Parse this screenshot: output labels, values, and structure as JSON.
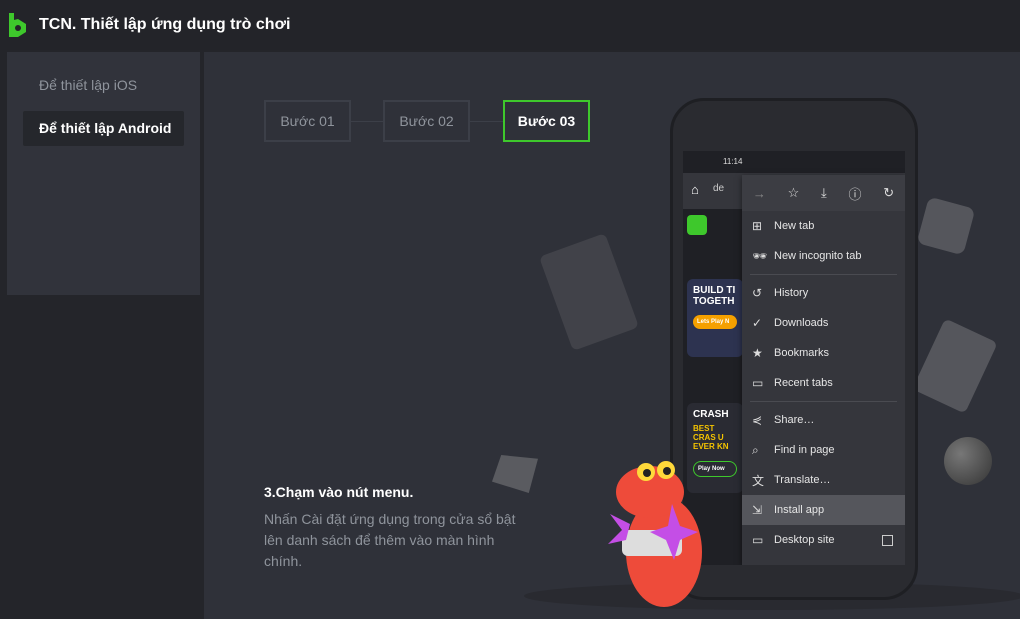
{
  "header": {
    "title": "TCN. Thiết lập ứng dụng trò chơi",
    "logo_color": "#3ec82c"
  },
  "sidebar": {
    "items": [
      {
        "label": "Để thiết lập iOS"
      },
      {
        "label": "Để thiết lập Android",
        "active": true
      }
    ]
  },
  "steps": [
    {
      "label": "Bước 01"
    },
    {
      "label": "Bước 02"
    },
    {
      "label": "Bước 03",
      "active": true
    }
  ],
  "instruction": {
    "title": "3.Chạm vào nút menu.",
    "text": "Nhấn Cài đặt ứng dụng trong cửa sổ bật lên danh sách để thêm vào màn hình chính."
  },
  "phone": {
    "time": "11:14",
    "address_partial": "de",
    "web": {
      "banner1": "BUILD TI TOGETH",
      "banner1_button": "Lets Play N",
      "banner2": "CRASH",
      "banner2_sub": "BEST CRAS U EVER KN",
      "banner2_button": "Play Now"
    },
    "menu": [
      {
        "icon": "plus-square-icon",
        "label": "New tab"
      },
      {
        "icon": "incognito-icon",
        "label": "New incognito tab"
      },
      {
        "separator": true
      },
      {
        "icon": "history-icon",
        "label": "History"
      },
      {
        "icon": "download-done-icon",
        "label": "Downloads"
      },
      {
        "icon": "star-icon",
        "label": "Bookmarks"
      },
      {
        "icon": "devices-icon",
        "label": "Recent tabs"
      },
      {
        "separator": true
      },
      {
        "icon": "share-icon",
        "label": "Share…"
      },
      {
        "icon": "find-icon",
        "label": "Find in page"
      },
      {
        "icon": "translate-icon",
        "label": "Translate…"
      },
      {
        "icon": "install-app-icon",
        "label": "Install app",
        "highlighted": true
      },
      {
        "icon": "desktop-icon",
        "label": "Desktop site",
        "checkbox": false
      }
    ]
  },
  "colors": {
    "accent": "#3ec82c",
    "background": "#2f3139"
  }
}
